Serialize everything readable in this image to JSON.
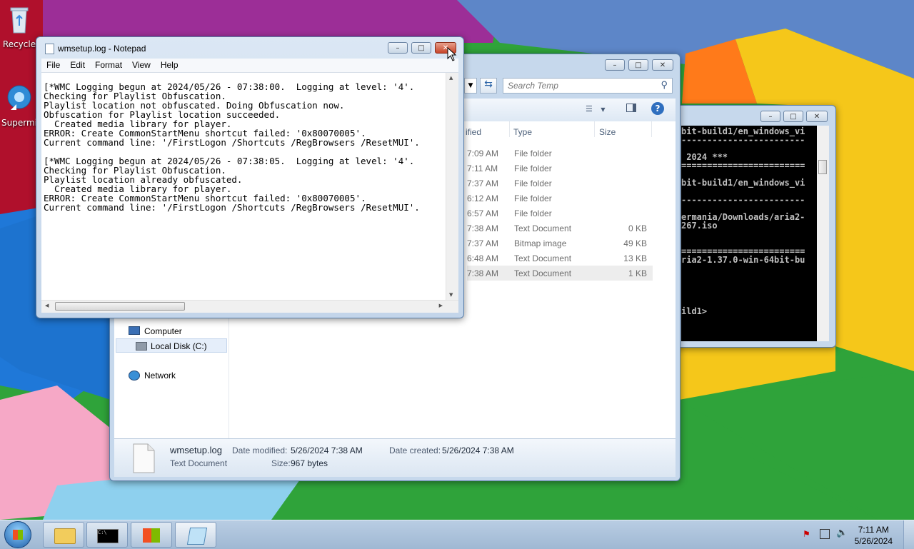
{
  "desktop": {
    "icons": [
      {
        "label": "Recycle"
      },
      {
        "label": "Supermi"
      }
    ]
  },
  "notepad": {
    "title": "wmsetup.log - Notepad",
    "menu": [
      "File",
      "Edit",
      "Format",
      "View",
      "Help"
    ],
    "content": "[*WMC Logging begun at 2024/05/26 - 07:38:00.  Logging at level: '4'.\nChecking for Playlist Obfuscation.\nPlaylist location not obfuscated. Doing Obfuscation now.\nObfuscation for Playlist location succeeded.\n  Created media library for player.\nERROR: Create CommonStartMenu shortcut failed: '0x80070005'.\nCurrent command line: '/FirstLogon /Shortcuts /RegBrowsers /ResetMUI'.\n\n[*WMC Logging begun at 2024/05/26 - 07:38:05.  Logging at level: '4'.\nChecking for Playlist Obfuscation.\nPlaylist location already obfuscated.\n  Created media library for player.\nERROR: Create CommonStartMenu shortcut failed: '0x80070005'.\nCurrent command line: '/FirstLogon /Shortcuts /RegBrowsers /ResetMUI'."
  },
  "explorer": {
    "search_placeholder": "Search Temp",
    "columns": {
      "modified": "ified",
      "type": "Type",
      "size": "Size"
    },
    "rows": [
      {
        "time": "7:09 AM",
        "type": "File folder",
        "size": ""
      },
      {
        "time": "7:11 AM",
        "type": "File folder",
        "size": ""
      },
      {
        "time": "7:37 AM",
        "type": "File folder",
        "size": ""
      },
      {
        "time": "6:12 AM",
        "type": "File folder",
        "size": ""
      },
      {
        "time": "6:57 AM",
        "type": "File folder",
        "size": ""
      },
      {
        "time": "7:38 AM",
        "type": "Text Document",
        "size": "0 KB"
      },
      {
        "time": "7:37 AM",
        "type": "Bitmap image",
        "size": "49 KB"
      },
      {
        "time": "6:48 AM",
        "type": "Text Document",
        "size": "13 KB"
      },
      {
        "time": "7:38 AM",
        "type": "Text Document",
        "size": "1 KB"
      }
    ],
    "nav": {
      "computer": "Computer",
      "local_disk": "Local Disk (C:)",
      "network": "Network"
    },
    "details": {
      "filename": "wmsetup.log",
      "filetype": "Text Document",
      "date_modified_label": "Date modified:",
      "date_modified": "5/26/2024 7:38 AM",
      "date_created_label": "Date created:",
      "date_created": "5/26/2024 7:38 AM",
      "size_label": "Size:",
      "size": "967 bytes"
    }
  },
  "cmd": {
    "content": "bit-build1/en_windows_vi\n------------------------\n\n 2024 ***\n========================\n\nbit-build1/en_windows_vi\n\n------------------------\n\nermania/Downloads/aria2-\n267.iso\n\n\n========================\nria2-1.37.0-win-64bit-bu\n\n\n\n\n\nild1>"
  },
  "taskbar": {
    "time": "7:11 AM",
    "date": "5/26/2024"
  }
}
